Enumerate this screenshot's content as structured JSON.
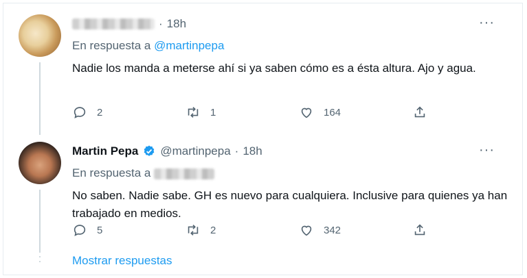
{
  "tweets": [
    {
      "name": "",
      "handle": "",
      "time": "18h",
      "reply_prefix": "En respuesta a",
      "reply_to": "@martinpepa",
      "text": "Nadie los manda a meterse ahí si ya saben cómo es a ésta altura. Ajo y agua.",
      "replies": "2",
      "retweets": "1",
      "likes": "164"
    },
    {
      "name": "Martin Pepa",
      "handle": "@martinpepa",
      "time": "18h",
      "reply_prefix": "En respuesta a",
      "reply_to": "",
      "text": "No saben. Nadie sabe. GH es nuevo para cualquiera. Inclusive para quienes ya han trabajado en medios.",
      "replies": "5",
      "retweets": "2",
      "likes": "342"
    }
  ],
  "separator": "·",
  "more_label": "···",
  "show_replies": "Mostrar respuestas",
  "colors": {
    "link": "#1d9bf0",
    "muted": "#536471",
    "text": "#0f1419"
  },
  "icons": [
    "reply-icon",
    "retweet-icon",
    "like-icon",
    "share-icon",
    "verified-icon",
    "more-icon"
  ]
}
